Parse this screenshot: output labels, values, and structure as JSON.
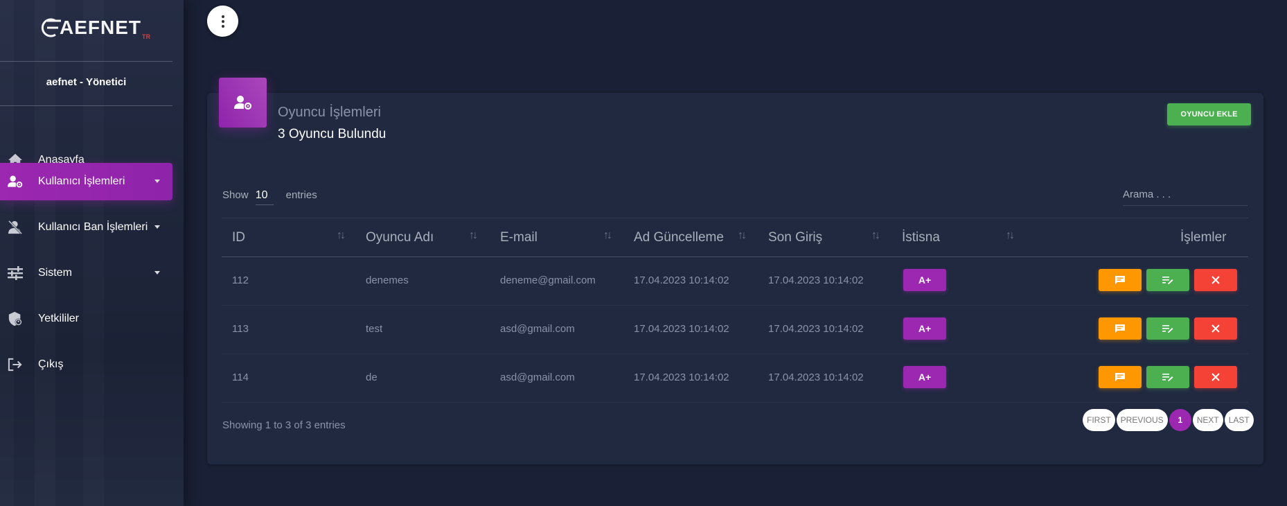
{
  "brand": {
    "logo_text": "AEFNET",
    "logo_sub": "TR"
  },
  "user": {
    "name": "aefnet - Yönetici"
  },
  "nav": [
    {
      "label": "Anasayfa",
      "icon": "home-icon",
      "active": false,
      "caret": false
    },
    {
      "label": "Kullanıcı İşlemleri",
      "icon": "user-settings-icon",
      "active": true,
      "caret": true
    },
    {
      "label": "Kullanıcı Ban İşlemleri",
      "icon": "user-ban-icon",
      "active": false,
      "caret": true
    },
    {
      "label": "Sistem",
      "icon": "sliders-icon",
      "active": false,
      "caret": true
    },
    {
      "label": "Yetkililer",
      "icon": "shield-user-icon",
      "active": false,
      "caret": false
    },
    {
      "label": "Çıkış",
      "icon": "logout-icon",
      "active": false,
      "caret": false
    }
  ],
  "card": {
    "title": "Oyuncu İşlemleri",
    "subtitle": "3 Oyuncu Bulundu",
    "add_button": "OYUNCU EKLE"
  },
  "table_controls": {
    "show_label": "Show",
    "show_value": "10",
    "entries_label": "entries",
    "search_placeholder": "Arama . . ."
  },
  "columns": [
    "ID",
    "Oyuncu Adı",
    "E-mail",
    "Ad Güncelleme",
    "Son Giriş",
    "İstisna",
    "İşlemler"
  ],
  "rows": [
    {
      "id": "112",
      "name": "denemes",
      "email": "deneme@gmail.com",
      "ad_update": "17.04.2023 10:14:02",
      "last_login": "17.04.2023 10:14:02",
      "exception": "A+"
    },
    {
      "id": "113",
      "name": "test",
      "email": "asd@gmail.com",
      "ad_update": "17.04.2023 10:14:02",
      "last_login": "17.04.2023 10:14:02",
      "exception": "A+"
    },
    {
      "id": "114",
      "name": "de",
      "email": "asd@gmail.com",
      "ad_update": "17.04.2023 10:14:02",
      "last_login": "17.04.2023 10:14:02",
      "exception": "A+"
    }
  ],
  "footer": {
    "info": "Showing 1 to 3 of 3 entries",
    "pager": {
      "first": "FIRST",
      "previous": "PREVIOUS",
      "current": "1",
      "next": "NEXT",
      "last": "LAST"
    }
  },
  "colors": {
    "accent": "#9c27b0",
    "success": "#4caf50",
    "warning": "#ff9800",
    "danger": "#f44336",
    "background": "#1a2035",
    "card": "#202940"
  }
}
